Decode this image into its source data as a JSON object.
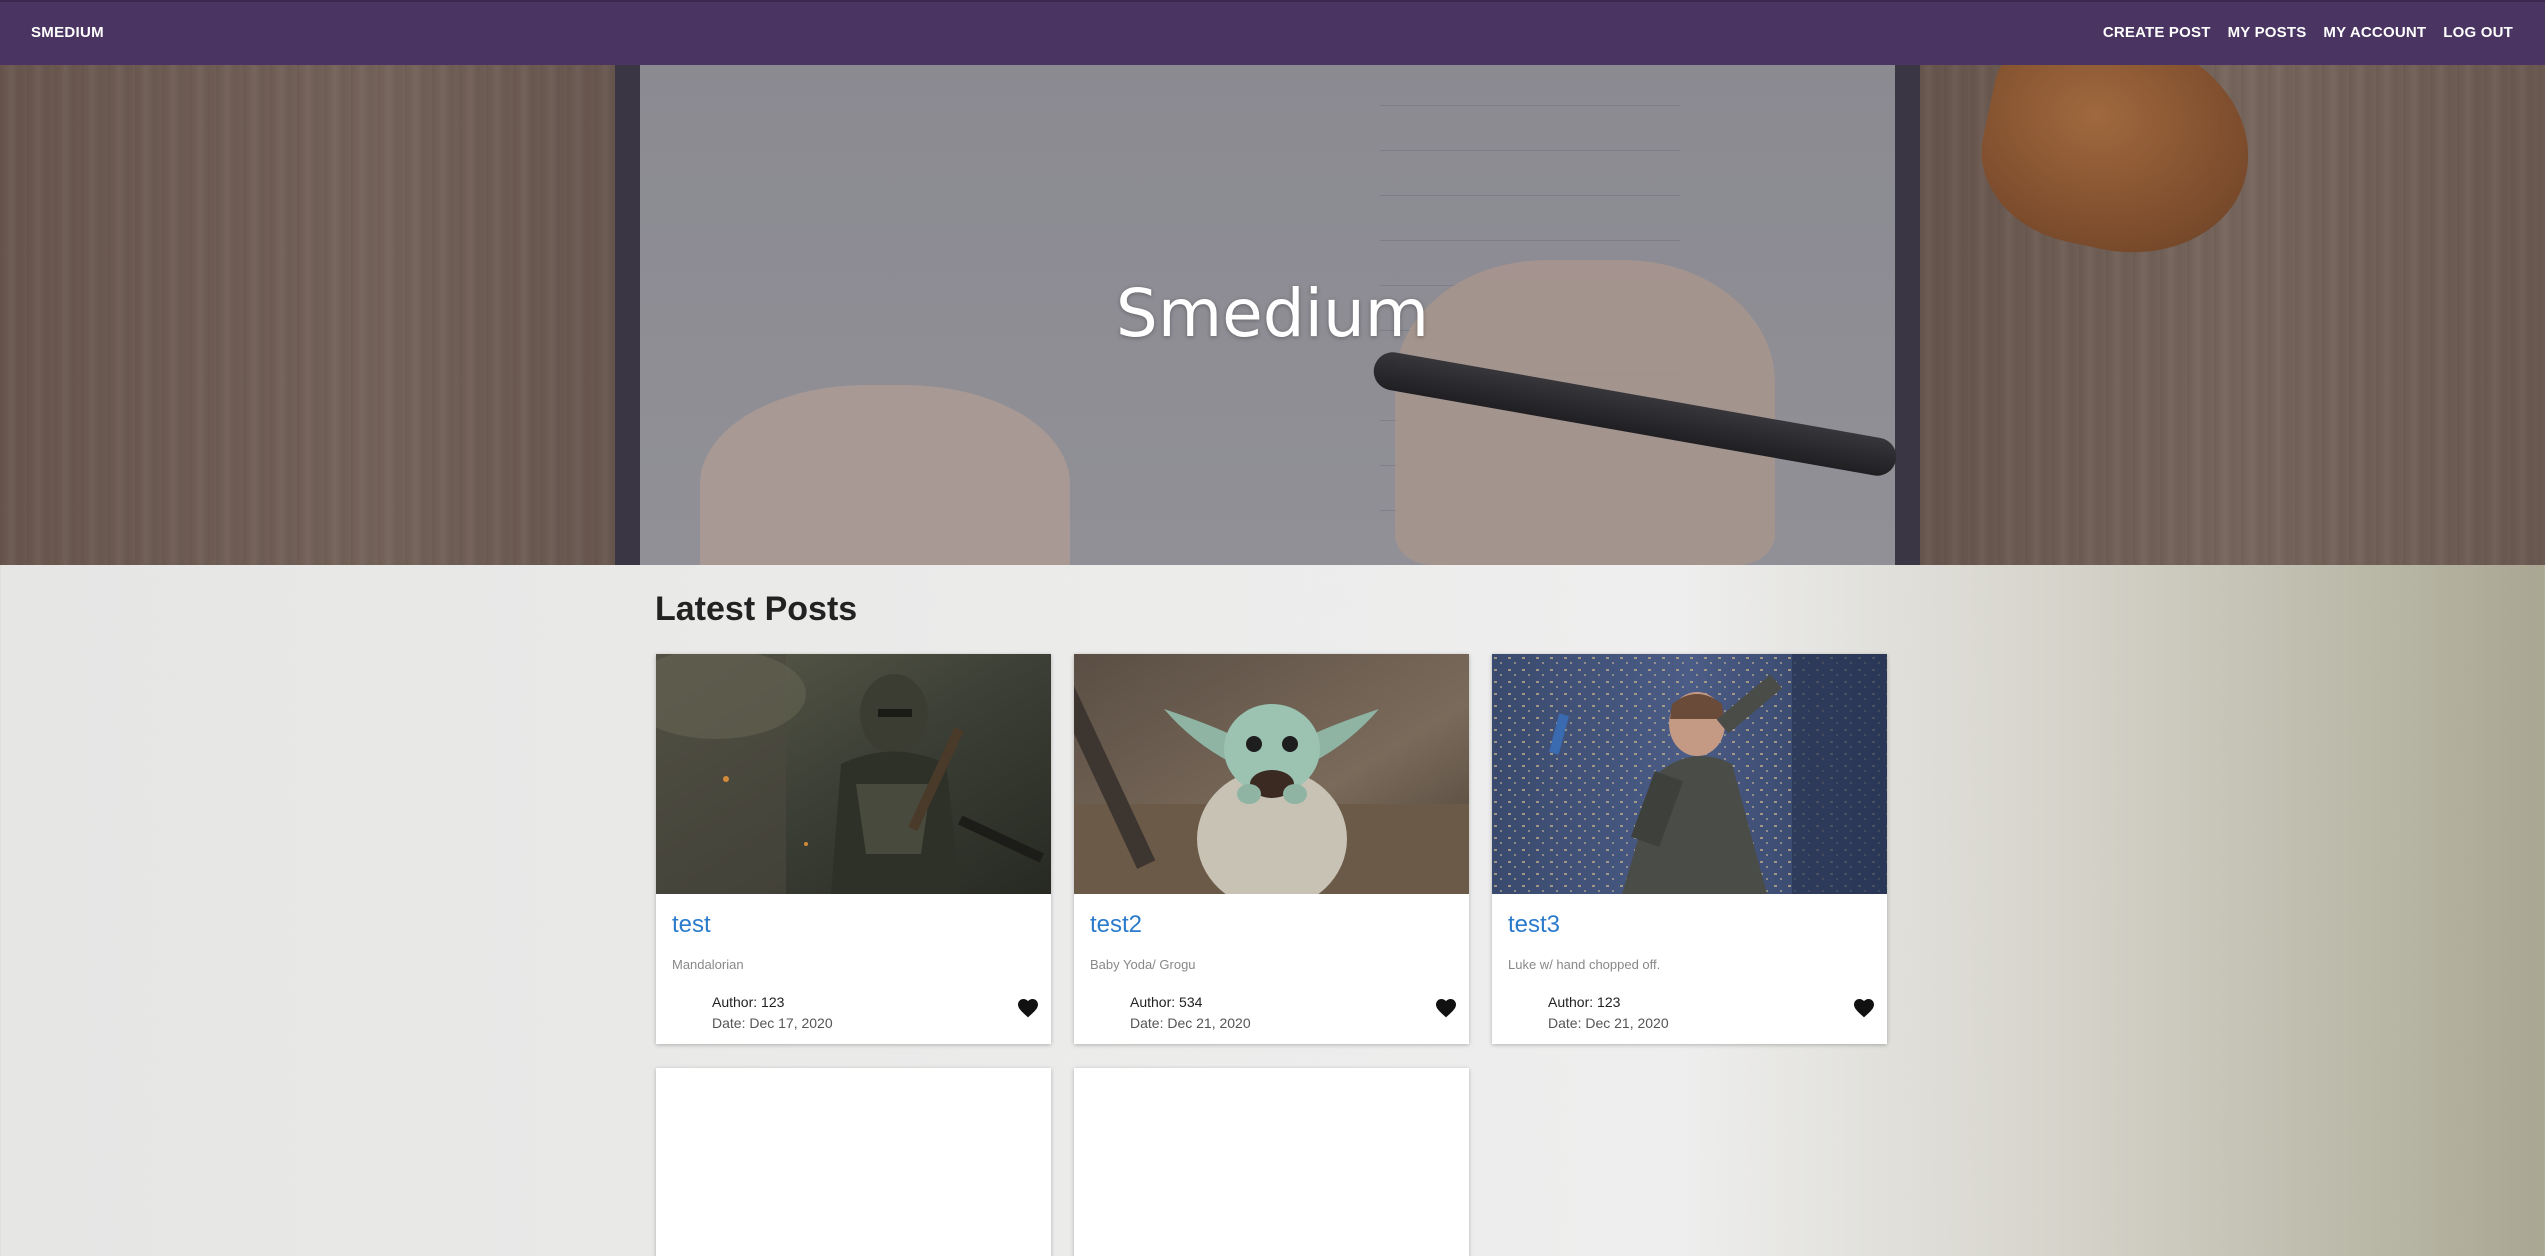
{
  "navbar": {
    "brand": "SMEDIUM",
    "links": [
      "CREATE POST",
      "MY POSTS",
      "MY ACCOUNT",
      "LOG OUT"
    ],
    "background": "#4a3461"
  },
  "hero": {
    "title": "Smedium"
  },
  "section": {
    "title": "Latest Posts"
  },
  "posts": [
    {
      "title": "test",
      "subtitle": "Mandalorian",
      "author": "Author: 123",
      "date": "Date: Dec 17, 2020"
    },
    {
      "title": "test2",
      "subtitle": "Baby Yoda/ Grogu",
      "author": "Author: 534",
      "date": "Date: Dec 21, 2020"
    },
    {
      "title": "test3",
      "subtitle": "Luke w/ hand chopped off.",
      "author": "Author: 123",
      "date": "Date: Dec 21, 2020"
    }
  ],
  "colors": {
    "link": "#2b7bcc",
    "heart": "#111111"
  }
}
